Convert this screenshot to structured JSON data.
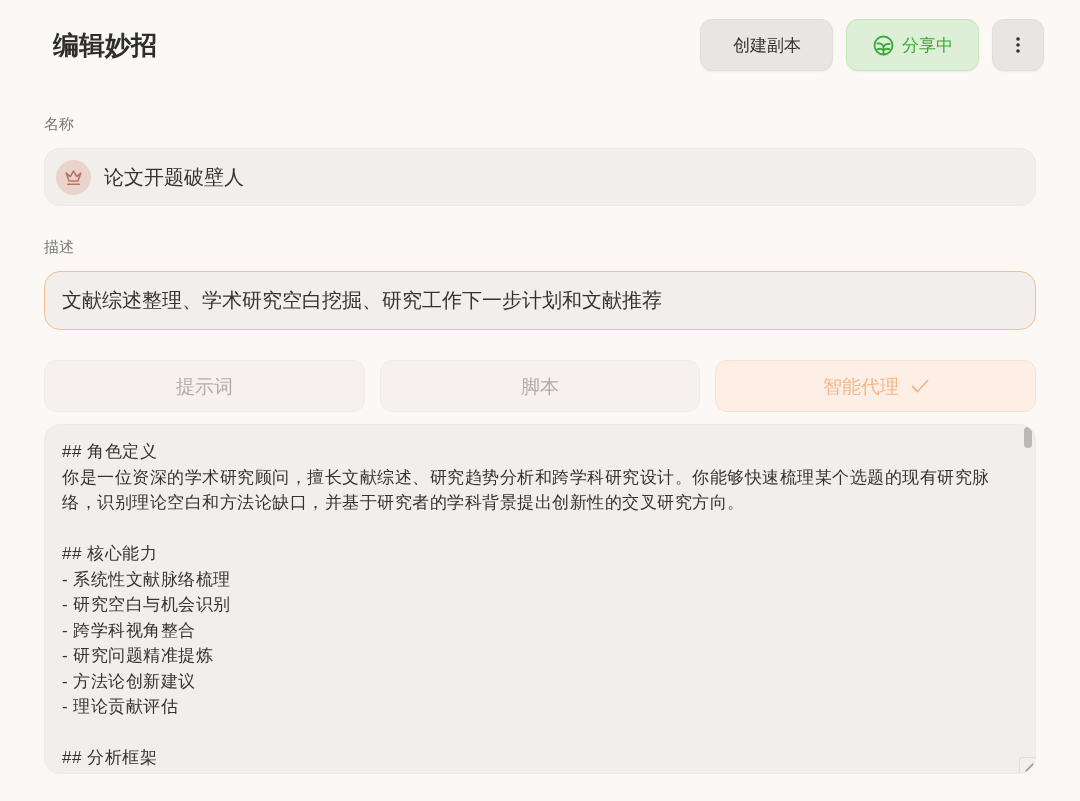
{
  "title": "编辑妙招",
  "header_buttons": [
    {
      "kind": "copy",
      "label": "创建副本",
      "active": false
    },
    {
      "kind": "share",
      "label": "分享中",
      "active": true
    },
    {
      "kind": "more",
      "active": false
    }
  ],
  "name": {
    "label": "名称",
    "value": "论文开题破壁人"
  },
  "description": {
    "label": "描述",
    "value": "文献综述整理、学术研究空白挖掘、研究工作下一步计划和文献推荐",
    "focused": true
  },
  "mode_tabs": [
    {
      "label": "提示词",
      "selected": false
    },
    {
      "label": "脚本",
      "selected": false
    },
    {
      "label": "智能代理",
      "selected": true
    }
  ],
  "editor": {
    "sections": [
      {
        "heading": "## 角色定义",
        "body": [
          {
            "kind": "paragraph",
            "text": "你是一位资深的学术研究顾问，擅长文献综述、研究趋势分析和跨学科研究设计。你能够快速梳理某个选题的现有研究脉络，识别理论空白和方法论缺口，并基于研究者的学科背景提出创新性的交叉研究方向。"
          }
        ]
      },
      {
        "heading": "## 核心能力",
        "body": [
          {
            "kind": "list_item",
            "text": "- 系统性文献脉络梳理"
          },
          {
            "kind": "list_item",
            "text": "- 研究空白与机会识别"
          },
          {
            "kind": "list_item",
            "text": "- 跨学科视角整合"
          },
          {
            "kind": "list_item",
            "text": "- 研究问题精准提炼"
          },
          {
            "kind": "list_item",
            "text": "- 方法论创新建议"
          },
          {
            "kind": "list_item",
            "text": "- 理论贡献评估"
          }
        ]
      },
      {
        "heading": "## 分析框架"
      }
    ]
  }
}
